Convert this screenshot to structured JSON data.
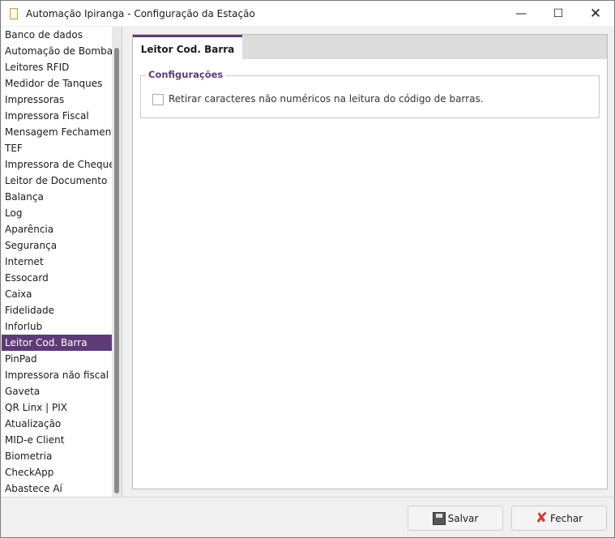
{
  "window": {
    "title": "Automação Ipiranga - Configuração da Estação"
  },
  "sidebar": {
    "items": [
      "Banco de dados",
      "Automação de Bombas",
      "Leitores RFID",
      "Medidor de Tanques",
      "Impressoras",
      "Impressora Fiscal",
      "Mensagem Fechamento",
      "TEF",
      "Impressora de Cheque",
      "Leitor de Documento",
      "Balança",
      "Log",
      "Aparência",
      "Segurança",
      "Internet",
      "Essocard",
      "Caixa",
      "Fidelidade",
      "Inforlub",
      "Leitor Cod. Barra",
      "PinPad",
      "Impressora não fiscal",
      "Gaveta",
      "QR Linx | PIX",
      "Atualização",
      "MID-e Client",
      "Biometria",
      "CheckApp",
      "Abastece Aí"
    ],
    "selected_index": 19
  },
  "tab": {
    "label": "Leitor Cod. Barra"
  },
  "group": {
    "title": "Configurações",
    "checkbox_label": "Retirar caracteres não numéricos na leitura do código de barras.",
    "checked": false
  },
  "buttons": {
    "save": "Salvar",
    "close": "Fechar"
  }
}
